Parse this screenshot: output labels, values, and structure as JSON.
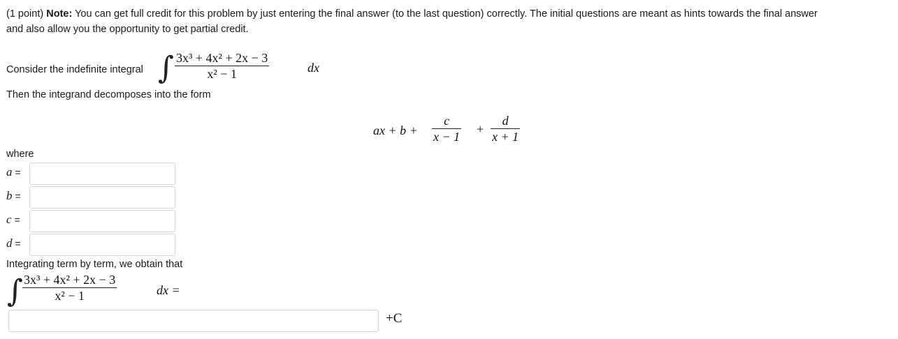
{
  "header": {
    "points": "(1 point)",
    "note_label": "Note:",
    "note_text": " You can get full credit for this problem by just entering the final answer (to the last question) correctly. The initial questions are meant as hints towards the final answer",
    "note_text2": "and also allow you the opportunity to get partial credit."
  },
  "problem": {
    "consider_label": "Consider the indefinite integral",
    "integrand_numerator": "3x³ + 4x² + 2x − 3",
    "integrand_denominator": "x² − 1",
    "dx": "dx",
    "then_label": "Then the integrand decomposes into the form",
    "form_lead": "ax + b +",
    "form_frac1_num": "c",
    "form_frac1_den": "x − 1",
    "form_plus": "+",
    "form_frac2_num": "d",
    "form_frac2_den": "x + 1",
    "where_label": "where"
  },
  "answers": {
    "a_label": "a",
    "b_label": "b",
    "c_label": "c",
    "d_label": "d",
    "equals": "=",
    "a_value": "",
    "b_value": "",
    "c_value": "",
    "d_value": ""
  },
  "final": {
    "integrating_label": "Integrating term by term, we obtain that",
    "dx_equals": "dx =",
    "final_value": "",
    "plus_c": "+C"
  }
}
